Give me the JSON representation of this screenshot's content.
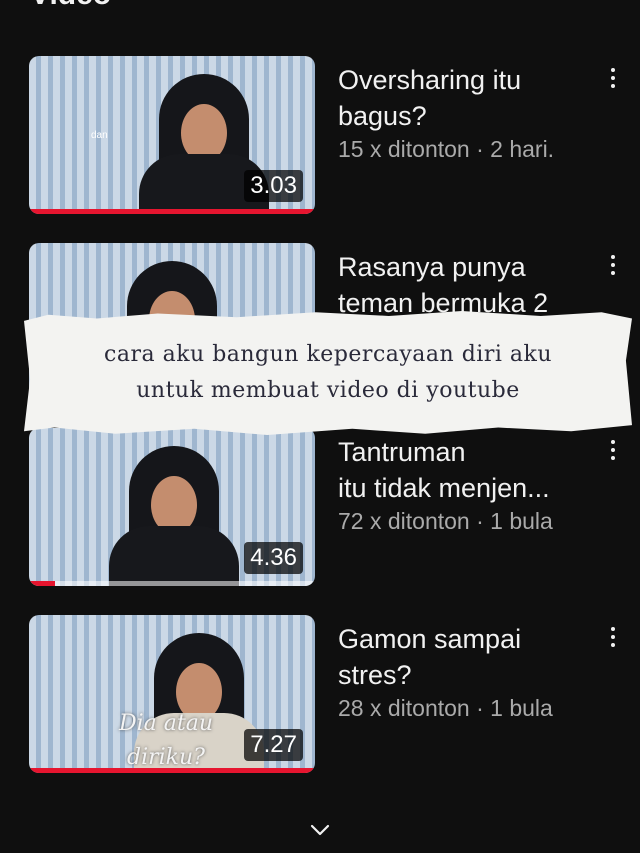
{
  "section": {
    "title": "Video"
  },
  "videos": [
    {
      "title_line1": "Oversharing itu",
      "title_line2": "bagus?",
      "meta": "15 x ditonton · 2 hari.",
      "duration": "3.03",
      "progress_fraction": 1.0,
      "thumb_text": "dan"
    },
    {
      "title_line1": "Rasanya punya",
      "title_line2": "teman bermuka 2",
      "meta": "",
      "duration": "",
      "progress_fraction": 0
    },
    {
      "title_line1": "Tantruman",
      "title_line2": "itu tidak menjen...",
      "meta": "72 x ditonton · 1 bula",
      "duration": "4.36",
      "progress_fraction": 0.09
    },
    {
      "title_line1": "Gamon sampai",
      "title_line2": "stres?",
      "meta": "28 x ditonton · 1 bula",
      "duration": "7.27",
      "progress_fraction": 1.0,
      "thumb_text_1": "Dia atau",
      "thumb_text_2": "diriku?"
    }
  ],
  "overlay": {
    "line1": "cara aku bangun kepercayaan diri aku",
    "line2": "untuk membuat video di youtube"
  },
  "icons": {
    "more": "more-vert-icon",
    "expand": "chevron-down-icon"
  },
  "colors": {
    "background": "#0f0f0f",
    "progress": "#e6152f",
    "meta": "#aaaaaa"
  }
}
